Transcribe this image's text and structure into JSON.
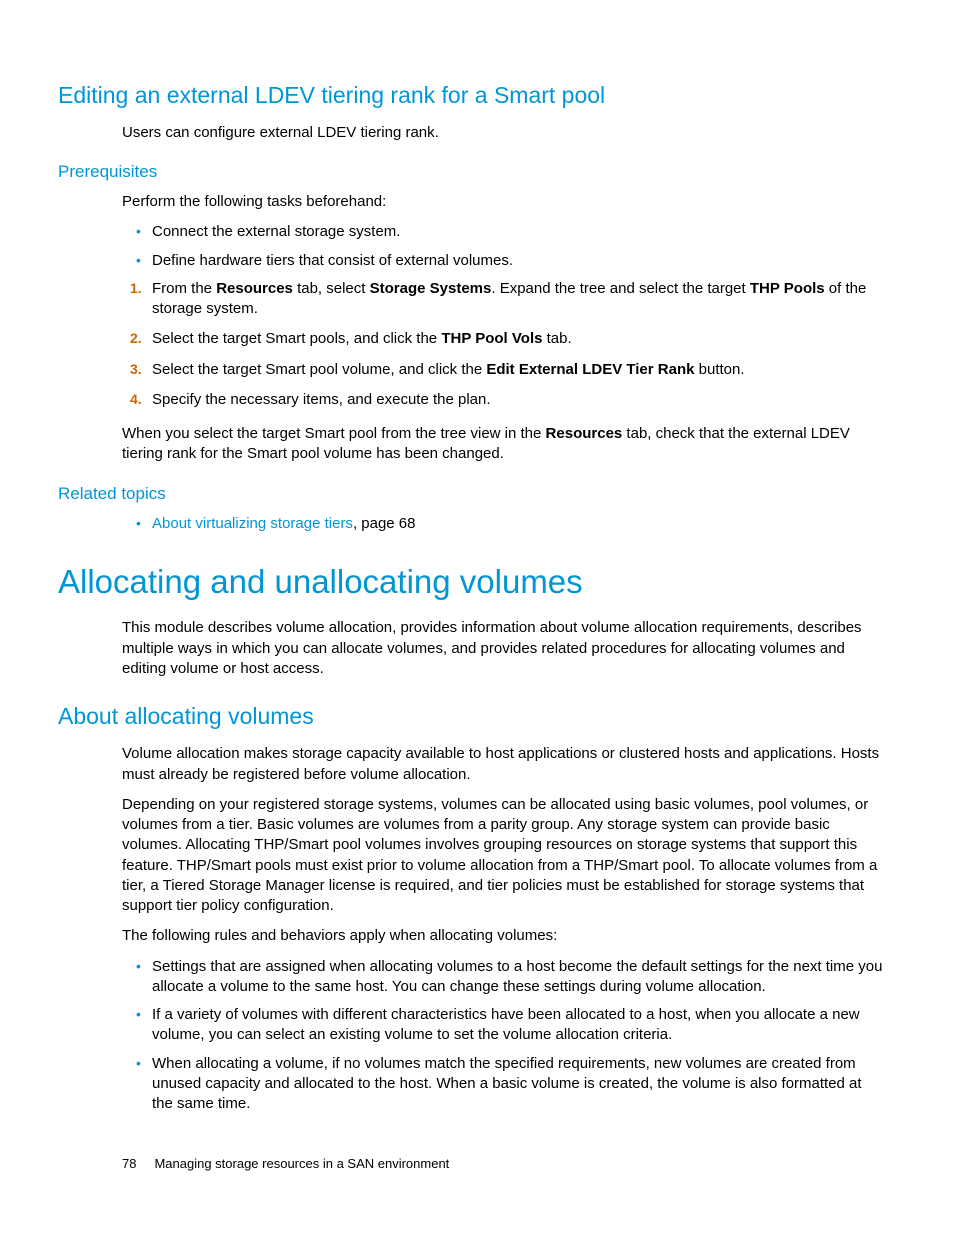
{
  "h_editing": "Editing an external LDEV tiering rank for a Smart pool",
  "p_intro1": "Users can configure external LDEV tiering rank.",
  "h_prereq": "Prerequisites",
  "p_prereq": "Perform the following tasks beforehand:",
  "bul1": "Connect the external storage system.",
  "bul2": "Define hardware tiers that consist of external volumes.",
  "step1_a": "From the ",
  "step1_b": "Resources",
  "step1_c": " tab, select ",
  "step1_d": "Storage Systems",
  "step1_e": ". Expand the tree and select the target ",
  "step1_f": "THP Pools",
  "step1_g": " of the storage system.",
  "step2_a": "Select the target Smart pools, and click the ",
  "step2_b": "THP Pool Vols",
  "step2_c": " tab.",
  "step3_a": "Select the target Smart pool volume, and click the ",
  "step3_b": "Edit External LDEV Tier Rank",
  "step3_c": " button.",
  "step4": "Specify the necessary items, and execute the plan.",
  "p_after_a": "When you select the target Smart pool from the tree view in the ",
  "p_after_b": "Resources",
  "p_after_c": " tab, check that the external LDEV tiering rank for the Smart pool volume has been changed.",
  "h_related": "Related topics",
  "rel_link": "About virtualizing storage tiers",
  "rel_tail": ", page 68",
  "h_alloc": "Allocating and unallocating volumes",
  "p_alloc1": "This module describes volume allocation, provides information about volume allocation requirements, describes multiple ways in which you can allocate volumes, and provides related procedures for allocating volumes and editing volume or host access.",
  "h_about": "About allocating volumes",
  "p_about1": "Volume allocation makes storage capacity available to host applications or clustered hosts and applications. Hosts must already be registered before volume allocation.",
  "p_about2": "Depending on your registered storage systems, volumes can be allocated using basic volumes, pool volumes, or volumes from a tier. Basic volumes are volumes from a parity group. Any storage system can provide basic volumes. Allocating THP/Smart pool volumes involves grouping resources on storage systems that support this feature. THP/Smart pools must exist prior to volume allocation from a THP/Smart pool. To allocate volumes from a tier, a Tiered Storage Manager license is required, and tier policies must be established for storage systems that support tier policy configuration.",
  "p_about3": "The following rules and behaviors apply when allocating volumes:",
  "rbul1": "Settings that are assigned when allocating volumes to a host become the default settings for the next time you allocate a volume to the same host. You can change these settings during volume allocation.",
  "rbul2": "If a variety of volumes with different characteristics have been allocated to a host, when you allocate a new volume, you can select an existing volume to set the volume allocation criteria.",
  "rbul3": "When allocating a volume, if no volumes match the specified requirements, new volumes are created from unused capacity and allocated to the host. When a basic volume is created, the volume is also formatted at the same time.",
  "footer_page": "78",
  "footer_text": "Managing storage resources in a SAN environment"
}
